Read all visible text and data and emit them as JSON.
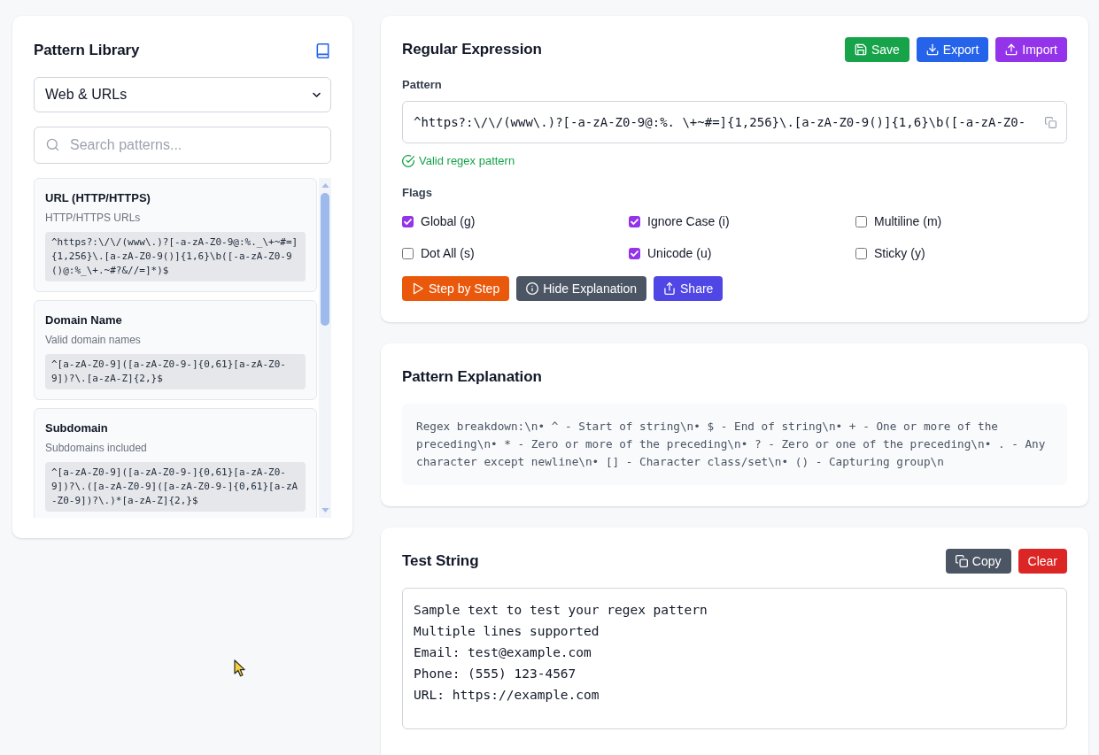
{
  "library": {
    "title": "Pattern Library",
    "category": "Web & URLs",
    "search": {
      "placeholder": "Search patterns..."
    },
    "patterns": [
      {
        "name": "URL (HTTP/HTTPS)",
        "description": "HTTP/HTTPS URLs",
        "regex": "^https?:\\/\\/(www\\.)?[-a-zA-Z0-9@:%._\\+~#=]{1,256}\\.[a-zA-Z0-9()]{1,6}\\b([-a-zA-Z0-9()@:%_\\+.~#?&//=]*)$"
      },
      {
        "name": "Domain Name",
        "description": "Valid domain names",
        "regex": "^[a-zA-Z0-9]([a-zA-Z0-9-]{0,61}[a-zA-Z0-9])?\\.[a-zA-Z]{2,}$"
      },
      {
        "name": "Subdomain",
        "description": "Subdomains included",
        "regex": "^[a-zA-Z0-9]([a-zA-Z0-9-]{0,61}[a-zA-Z0-9])?\\.([a-zA-Z0-9]([a-zA-Z0-9-]{0,61}[a-zA-Z0-9])?\\.)*[a-zA-Z]{2,}$"
      }
    ]
  },
  "editor": {
    "title": "Regular Expression",
    "actions": [
      {
        "label": "Save",
        "kind": "save"
      },
      {
        "label": "Export",
        "kind": "export"
      },
      {
        "label": "Import",
        "kind": "import"
      }
    ],
    "pattern_label": "Pattern",
    "pattern": "^https?:\\/\\/(www\\.)?[-a-zA-Z0-9@:%._\\+~#=]{1,256}\\.[a-zA-Z0-9()]{1,6}\\b([-a-zA-Z0-",
    "validation": {
      "valid": true,
      "message": "Valid regex pattern"
    },
    "flags_label": "Flags",
    "flags": [
      {
        "label": "Global (g)",
        "checked": true
      },
      {
        "label": "Ignore Case (i)",
        "checked": true
      },
      {
        "label": "Multiline (m)",
        "checked": false
      },
      {
        "label": "Dot All (s)",
        "checked": false
      },
      {
        "label": "Unicode (u)",
        "checked": true
      },
      {
        "label": "Sticky (y)",
        "checked": false
      }
    ],
    "tools": [
      {
        "label": "Step by Step",
        "kind": "step"
      },
      {
        "label": "Hide Explanation",
        "kind": "explain"
      },
      {
        "label": "Share",
        "kind": "share"
      }
    ]
  },
  "explanation": {
    "title": "Pattern Explanation",
    "text": "Regex breakdown:\\n• ^ - Start of string\\n• $ - End of string\\n• + - One or more of the preceding\\n• * - Zero or more of the preceding\\n• ? - Zero or one of the preceding\\n• . - Any character except newline\\n• [] - Character class/set\\n• () - Capturing group\\n"
  },
  "test": {
    "title": "Test String",
    "actions": [
      {
        "label": "Copy",
        "kind": "copy"
      },
      {
        "label": "Clear",
        "kind": "clear"
      }
    ],
    "value": "Sample text to test your regex pattern\nMultiple lines supported\nEmail: test@example.com\nPhone: (555) 123-4567\nURL: https://example.com"
  }
}
